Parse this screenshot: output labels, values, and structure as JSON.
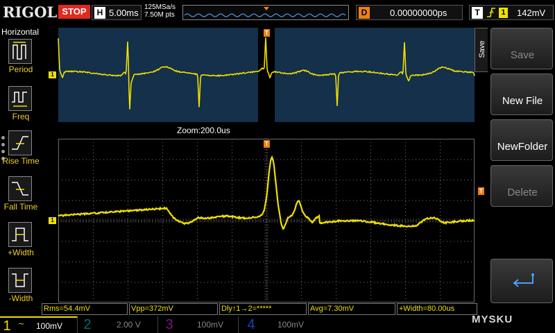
{
  "header": {
    "brand": "RIGOL",
    "run_state": "STOP",
    "timebase_letter": "H",
    "timebase": "5.00ms",
    "sample_rate": "125MSa/s",
    "memory_depth": "7.50M pts",
    "delay_letter": "D",
    "delay": "0.00000000ps",
    "trigger_letter": "T",
    "trigger_channel": "1",
    "trigger_level": "142mV"
  },
  "left_panel": {
    "title": "Horizontal",
    "items": [
      {
        "label": "Period",
        "icon": "period-icon"
      },
      {
        "label": "Freq",
        "icon": "freq-icon"
      },
      {
        "label": "Rise Time",
        "icon": "rise-time-icon"
      },
      {
        "label": "Fall Time",
        "icon": "fall-time-icon"
      },
      {
        "label": "+Width",
        "icon": "positive-width-icon"
      },
      {
        "label": "-Width",
        "icon": "negative-width-icon"
      }
    ]
  },
  "zoom": {
    "label": "Zoom:200.0us",
    "channel_marker": "1",
    "trigger_marker": "T"
  },
  "main": {
    "channel_marker": "1",
    "trigger_marker": "T",
    "level_marker": "T"
  },
  "measurements": [
    {
      "text": "Rms=54.4mV"
    },
    {
      "text": "Vpp=372mV"
    },
    {
      "text": "Dly↑1→2=*****"
    },
    {
      "text": "Avg=7.30mV"
    },
    {
      "text": "+Width=80.00us"
    }
  ],
  "channels": [
    {
      "number": "1",
      "coupling": "~",
      "scale": "100mV",
      "active": true,
      "color": "#f0e000"
    },
    {
      "number": "2",
      "coupling": "",
      "scale": "2.00 V",
      "active": false,
      "color": "#00c8c8"
    },
    {
      "number": "3",
      "coupling": "",
      "scale": "100mV",
      "active": false,
      "color": "#d020d0"
    },
    {
      "number": "4",
      "coupling": "",
      "scale": "100mV",
      "active": false,
      "color": "#2060ff"
    }
  ],
  "right_menu": {
    "tab_label": "Save",
    "buttons": [
      {
        "label": "Save",
        "enabled": false
      },
      {
        "label": "New File",
        "enabled": true
      },
      {
        "label": "NewFolder",
        "enabled": true
      },
      {
        "label": "Delete",
        "enabled": false
      }
    ],
    "back_icon": "return-arrow-icon"
  },
  "watermark": "MYSKU",
  "colors": {
    "channel1": "#f0e000",
    "stop": "#e02a1f",
    "trigger": "#f08010",
    "zoom_background": "#14304a"
  }
}
